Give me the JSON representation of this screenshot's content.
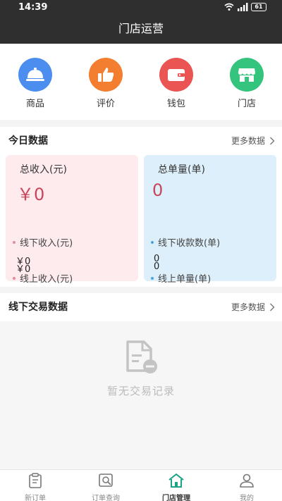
{
  "status": {
    "time": "14:39",
    "battery": "61"
  },
  "header": {
    "title": "门店运营"
  },
  "quick": [
    {
      "label": "商品",
      "icon": "food-cloche-icon",
      "color": "#4b8ef0"
    },
    {
      "label": "评价",
      "icon": "thumbs-up-icon",
      "color": "#f37e30"
    },
    {
      "label": "钱包",
      "icon": "wallet-icon",
      "color": "#ea5553"
    },
    {
      "label": "门店",
      "icon": "store-icon",
      "color": "#34c47e"
    }
  ],
  "today": {
    "title": "今日数据",
    "more": "更多数据",
    "income": {
      "title": "总收入(元)",
      "total": "￥0",
      "offline_label": "线下收入(元)",
      "offline_value": "￥0",
      "online_label": "线上收入(元)",
      "online_value": "￥0"
    },
    "orders": {
      "title": "总单量(单)",
      "total": "0",
      "offline_label": "线下收款数(单)",
      "offline_value": "0",
      "online_label": "线上单量(单)",
      "online_value": "0"
    }
  },
  "offline": {
    "title": "线下交易数据",
    "more": "更多数据",
    "empty": "暂无交易记录"
  },
  "tabs": [
    {
      "label": "新订单",
      "icon": "clipboard-icon"
    },
    {
      "label": "订单查询",
      "icon": "search-order-icon"
    },
    {
      "label": "门店管理",
      "icon": "home-icon",
      "active": true
    },
    {
      "label": "我的",
      "icon": "user-icon"
    }
  ],
  "colors": {
    "header": "#2f2f2f",
    "income_card": "#fdebee",
    "orders_card": "#dceffa",
    "accent_red": "#c9455a",
    "active_tab": "#1aa385"
  }
}
